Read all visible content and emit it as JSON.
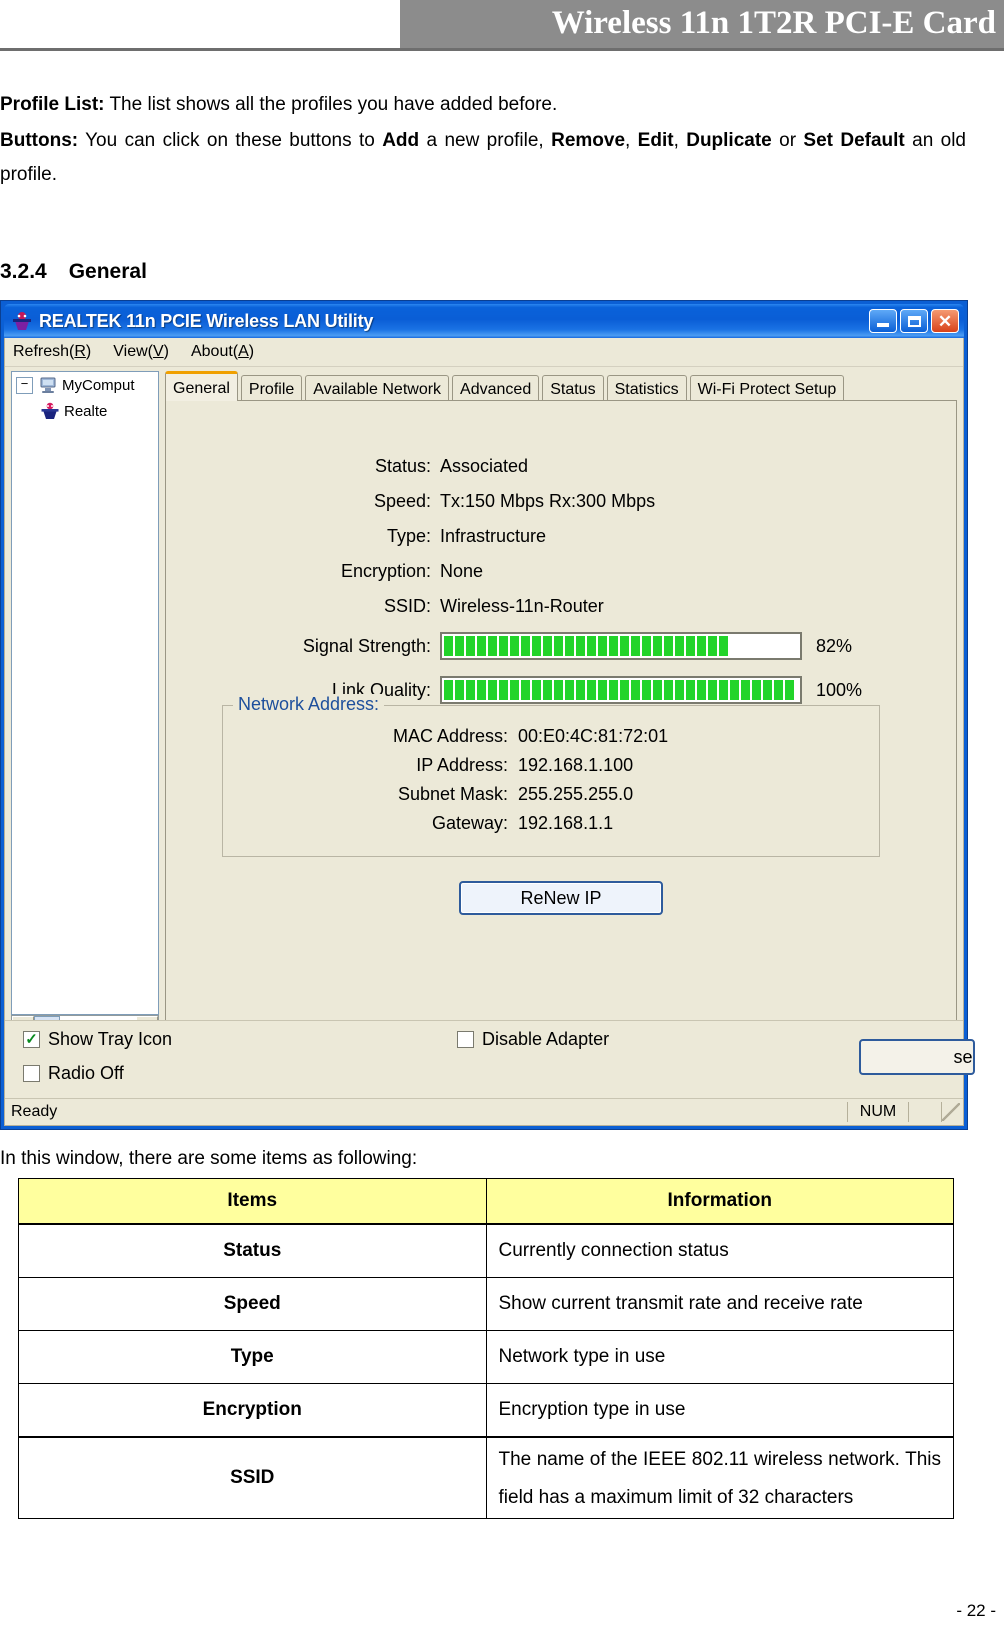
{
  "doc": {
    "running_header": "Wireless 11n 1T2R PCI-E Card",
    "profile_list_label": "Profile List:",
    "profile_list_text": " The list shows all the profiles you have added before.",
    "buttons_label": "Buttons:",
    "buttons_text_1": " You can click on these buttons to ",
    "buttons_add": "Add",
    "buttons_text_2": " a new profile, ",
    "buttons_remove": "Remove",
    "buttons_sep1": ", ",
    "buttons_edit": "Edit",
    "buttons_sep2": ", ",
    "buttons_duplicate": "Duplicate",
    "buttons_text_3": " or ",
    "buttons_setdefault": "Set Default",
    "buttons_text_4": " an old profile.",
    "section_number": "3.2.4",
    "section_title": "General",
    "intro_line": "In this window, there are some items as following:",
    "page_number": "- 22 -"
  },
  "window": {
    "title": "REALTEK 11n PCIE Wireless LAN Utility",
    "app_icon": "realtek-logo-icon",
    "minimize_label": "_",
    "maximize_label": "□",
    "close_label": "✕",
    "menus": [
      {
        "label": "Refresh(",
        "accel": "R",
        "tail": ")"
      },
      {
        "label": "View(",
        "accel": "V",
        "tail": ")"
      },
      {
        "label": "About(",
        "accel": "A",
        "tail": ")"
      }
    ],
    "tree": {
      "root_label": "MyComput",
      "root_expander": "−",
      "child_label": "Realte"
    },
    "tabs": [
      {
        "label": "General",
        "active": true
      },
      {
        "label": "Profile",
        "active": false
      },
      {
        "label": "Available Network",
        "active": false
      },
      {
        "label": "Advanced",
        "active": false
      },
      {
        "label": "Status",
        "active": false
      },
      {
        "label": "Statistics",
        "active": false
      },
      {
        "label": "Wi-Fi Protect Setup",
        "active": false
      }
    ],
    "general": {
      "status_label": "Status:",
      "status_value": "Associated",
      "speed_label": "Speed:",
      "speed_value": "Tx:150 Mbps Rx:300 Mbps",
      "type_label": "Type:",
      "type_value": "Infrastructure",
      "encryption_label": "Encryption:",
      "encryption_value": "None",
      "ssid_label": "SSID:",
      "ssid_value": "Wireless-11n-Router",
      "signal_label": "Signal Strength:",
      "signal_percent": "82%",
      "signal_value": 82,
      "link_label": "Link Quality:",
      "link_percent": "100%",
      "link_value": 100,
      "bar_color": "#22d42a"
    },
    "network_address": {
      "legend": "Network Address:",
      "mac_label": "MAC Address:",
      "mac_value": "00:E0:4C:81:72:01",
      "ip_label": "IP Address:",
      "ip_value": "192.168.1.100",
      "subnet_label": "Subnet Mask:",
      "subnet_value": "255.255.255.0",
      "gateway_label": "Gateway:",
      "gateway_value": "192.168.1.1"
    },
    "renew_button": "ReNew IP",
    "options": {
      "show_tray_icon": "Show Tray Icon",
      "show_tray_icon_checked": true,
      "radio_off": "Radio Off",
      "radio_off_checked": false,
      "disable_adapter": "Disable Adapter",
      "disable_adapter_checked": false,
      "check_glyph": "✓",
      "close_button": "se"
    },
    "statusbar": {
      "ready": "Ready",
      "num": "NUM"
    }
  },
  "items_table": {
    "headers": [
      "Items",
      "Information"
    ],
    "rows": [
      {
        "item": "Status",
        "info": "Currently connection status"
      },
      {
        "item": "Speed",
        "info": "Show current transmit rate and receive rate"
      },
      {
        "item": "Type",
        "info": "Network type in use"
      },
      {
        "item": "Encryption",
        "info": "Encryption type in use"
      },
      {
        "item": "SSID",
        "info": "The name of the IEEE 802.11 wireless network. This field has a maximum limit of 32 characters"
      }
    ]
  }
}
